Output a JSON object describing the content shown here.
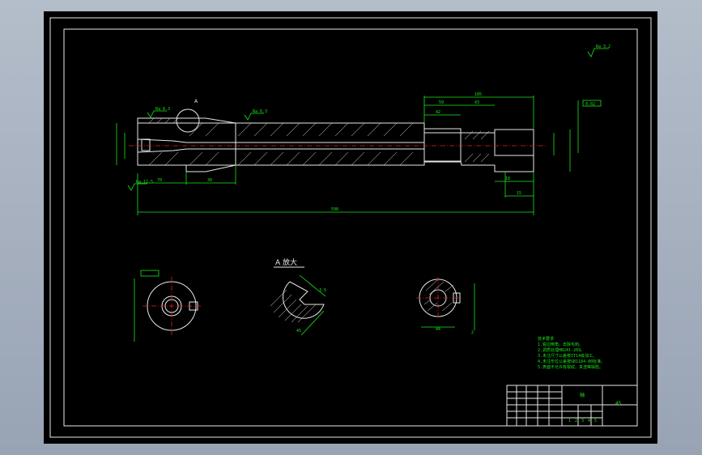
{
  "drawing": {
    "view_a_title": "A 放大",
    "section_mark": "A",
    "dims": {
      "total_length": "598",
      "d185": "185",
      "d59": "59",
      "d43": "43",
      "d42": "42",
      "d70": "70",
      "d30": "30",
      "d18": "18",
      "d15": "15",
      "d44": "44",
      "d2": "2",
      "d45": "45",
      "d3_5": "3.5"
    },
    "roughness": [
      "Ra 6.3",
      "Ra 6.3",
      "Ra 3.2",
      "Ra 12.5"
    ],
    "tolerance_frame": "0.02",
    "tech_req_title": "技术要求",
    "tech_req_lines": [
      "1.锐边倒角，去除毛刺。",
      "2.调质处理HB241-269。",
      "3.未注尺寸公差按IT14级加工。",
      "4.未注形位公差按GB1184-80标准。",
      "5.表面不允许有裂纹、夹渣等缺陷。"
    ],
    "title_block": {
      "part_name": "轴",
      "material": "45",
      "scale_cells": [
        "1",
        "2",
        "3",
        "4",
        "5"
      ]
    }
  }
}
